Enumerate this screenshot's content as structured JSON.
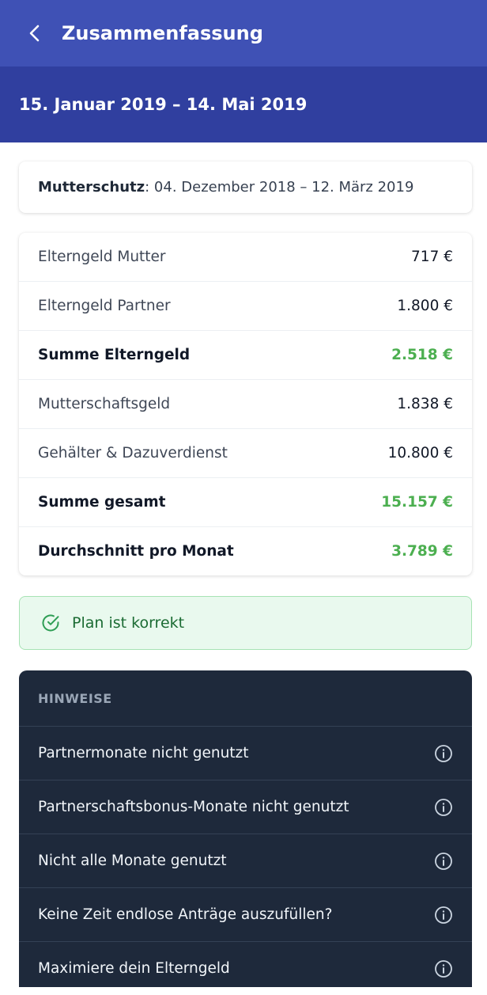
{
  "header": {
    "title": "Zusammenfassung"
  },
  "date_range": "15. Januar 2019 – 14. Mai 2019",
  "mutterschutz": {
    "label": "Mutterschutz",
    "value": ": 04. Dezember 2018 – 12. März 2019"
  },
  "summary": [
    {
      "label": "Elterngeld Mutter",
      "value": "717 €"
    },
    {
      "label": "Elterngeld Partner",
      "value": "1.800 €"
    },
    {
      "label": "Summe Elterngeld",
      "value": "2.518 €"
    },
    {
      "label": "Mutterschaftsgeld",
      "value": "1.838 €"
    },
    {
      "label": "Gehälter & Dazuverdienst",
      "value": "10.800 €"
    },
    {
      "label": "Summe gesamt",
      "value": "15.157 €"
    },
    {
      "label": "Durchschnitt pro Monat",
      "value": "3.789 €"
    }
  ],
  "status": {
    "text": "Plan ist korrekt",
    "icon": "check-circle-icon"
  },
  "hints": {
    "heading": "HINWEISE",
    "items": [
      {
        "label": "Partnermonate nicht genutzt",
        "icon": "info-icon"
      },
      {
        "label": "Partnerschaftsbonus-Monate nicht genutzt",
        "icon": "info-icon"
      },
      {
        "label": "Nicht alle Monate genutzt",
        "icon": "info-icon"
      },
      {
        "label": "Keine Zeit endlose Anträge auszufüllen?",
        "icon": "info-icon"
      },
      {
        "label": "Maximiere dein Elterngeld",
        "icon": "info-icon"
      }
    ]
  },
  "colors": {
    "appbar": "#3f51b5",
    "range_band": "#303f9f",
    "accent_green": "#4caf50",
    "hints_bg": "#1e293b"
  }
}
